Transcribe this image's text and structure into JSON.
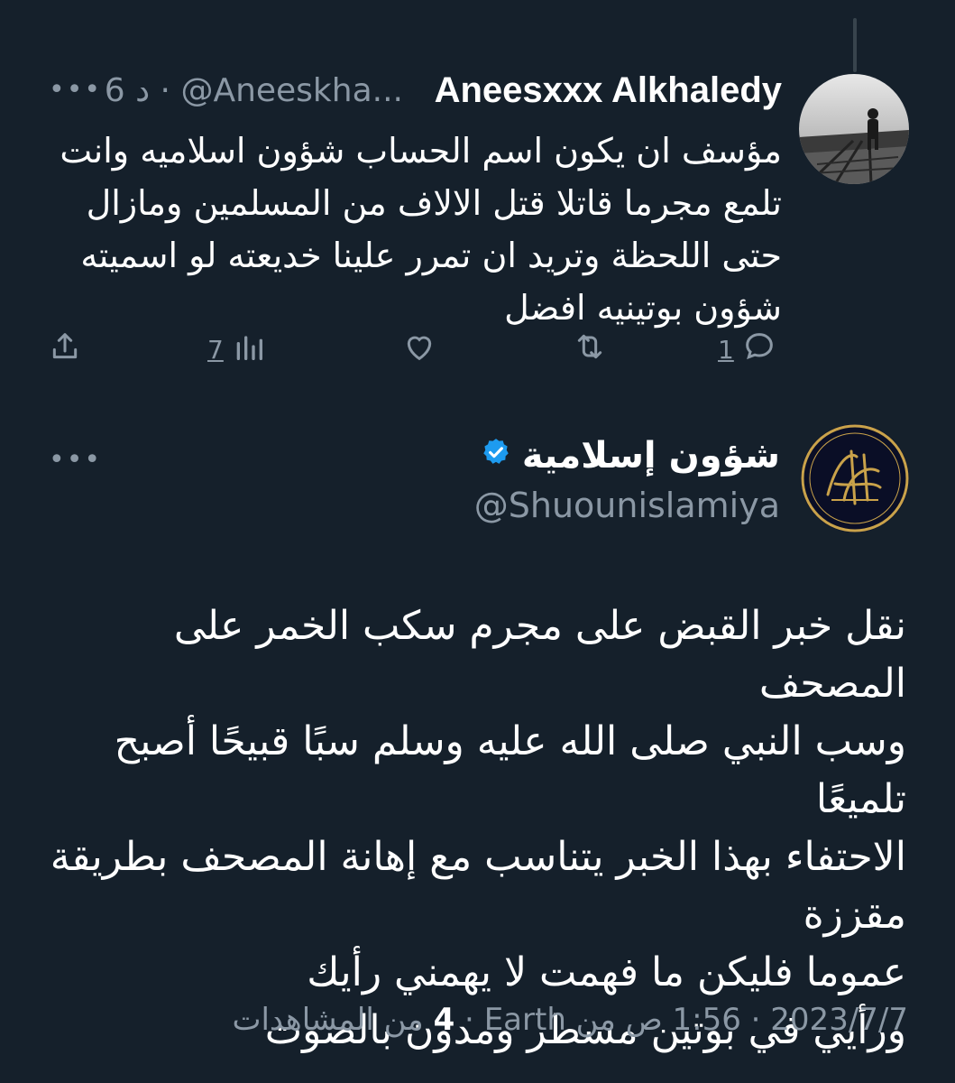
{
  "reply": {
    "display_name": "Aneesxxx Alkhaledy",
    "meta": "6 د · @Aneeskha...",
    "text_lines": [
      "مؤسف ان يكون اسم الحساب شؤون اسلاميه وانت",
      "تلمع مجرما قاتلا قتل الالاف من المسلمين ومازال",
      "حتى اللحظة وتريد ان تمرر علينا خديعته لو اسميته",
      "شؤون بوتينيه افضل"
    ],
    "actions": {
      "reply_count": "1",
      "views_count": "7"
    }
  },
  "main": {
    "display_name": "شؤون إسلامية",
    "handle": "@Shuounislamiya",
    "text_lines": [
      "نقل خبر القبض على مجرم سكب الخمر على المصحف",
      "وسب النبي صلى الله عليه وسلم سبًا قبيحًا أصبح تلميعًا",
      "الاحتفاء بهذا الخبر يتناسب مع إهانة المصحف بطريقة",
      "مقززة",
      "عموما فليكن ما فهمت لا يهمني رأيك",
      "ورأيي في بوتين مسطر ومدون بالصوت"
    ],
    "footer": {
      "datetime": "2023/7/7 · 1:56 ص من Earth",
      "views_number": "4",
      "views_label": "من المشاهدات"
    }
  },
  "icons": [
    "more-icon",
    "reply-icon",
    "retweet-icon",
    "like-icon",
    "views-icon",
    "share-icon",
    "verified-badge-icon"
  ],
  "colors": {
    "background": "#15202b",
    "muted": "#8b98a5",
    "verified": "#1d9bf0",
    "gold": "#c9a24a"
  }
}
